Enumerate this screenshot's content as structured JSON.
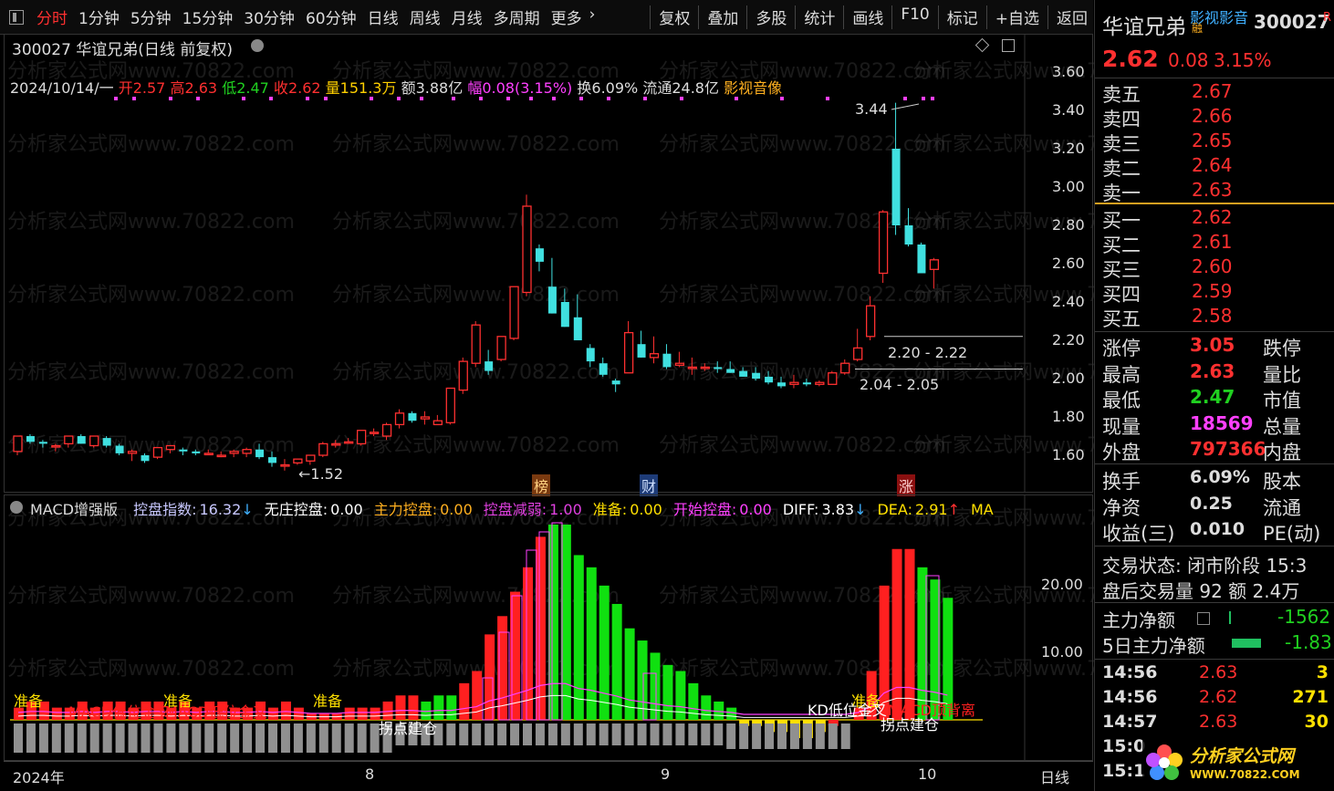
{
  "toolbar": {
    "items": [
      "分时",
      "1分钟",
      "5分钟",
      "15分钟",
      "30分钟",
      "60分钟",
      "日线",
      "周线",
      "月线",
      "多周期",
      "更多"
    ],
    "right_items": [
      "复权",
      "叠加",
      "多股",
      "统计",
      "画线",
      "F10",
      "标记",
      "+自选",
      "返回"
    ]
  },
  "main": {
    "title": "300027 华谊兄弟(日线 前复权)",
    "info": {
      "date": "2024/10/14/一",
      "open_label": "开",
      "open": "2.57",
      "high_label": "高",
      "high": "2.63",
      "low_label": "低",
      "low": "2.47",
      "close_label": "收",
      "close": "2.62",
      "vol_label": "量",
      "vol": "151.3万",
      "amt_label": "额",
      "amt": "3.88亿",
      "chg_label": "幅",
      "chg": "0.08(3.15%)",
      "turn_label": "换",
      "turn": "6.09%",
      "float_label": "流通",
      "float": "24.8亿",
      "sector": "影视音像"
    },
    "yticks": [
      "3.60",
      "3.40",
      "3.20",
      "3.00",
      "2.80",
      "2.60",
      "2.40",
      "2.20",
      "2.00",
      "1.80",
      "1.60"
    ],
    "annotations": {
      "peak": "3.44",
      "low_mark": "1.52",
      "band1": "2.20 - 2.22",
      "band2": "2.04 - 2.05"
    },
    "markers": {
      "bang": "榜",
      "cai": "财",
      "zhang": "涨"
    }
  },
  "sub": {
    "title": "MACD增强版",
    "items": [
      {
        "label": "控盘指数:",
        "value": "16.32",
        "arrow": "↓",
        "color": "#c8c8ff"
      },
      {
        "label": "无庄控盘:",
        "value": "0.00",
        "arrow": "",
        "color": "#ffffff"
      },
      {
        "label": "主力控盘:",
        "value": "0.00",
        "arrow": "",
        "color": "#ffb020"
      },
      {
        "label": "控盘减弱:",
        "value": "1.00",
        "arrow": "",
        "color": "#e040e0"
      },
      {
        "label": "准备:",
        "value": "0.00",
        "arrow": "",
        "color": "#ffe000"
      },
      {
        "label": "开始控盘:",
        "value": "0.00",
        "arrow": "",
        "color": "#ff40ff"
      },
      {
        "label": "DIFF:",
        "value": "3.83",
        "arrow": "↓",
        "color": "#ffffff"
      },
      {
        "label": "DEA:",
        "value": "2.91",
        "arrow": "↑",
        "color": "#ffe000"
      },
      {
        "label": "MA",
        "value": "",
        "arrow": "",
        "color": "#ffe000"
      }
    ],
    "yticks": [
      "20.00",
      "10.00"
    ],
    "signals": {
      "zhunbei": "准备",
      "macd_low1": "MACD低位金叉",
      "macd_low2": "MACD低位金叉",
      "guaidian": "拐点建仓",
      "kd_low": "KD低位金叉",
      "macd_top": "MACD顶背离"
    }
  },
  "xaxis": {
    "labels": [
      "2024年",
      "8",
      "9",
      "10"
    ],
    "period": "日线"
  },
  "right": {
    "name": "华谊兄弟",
    "sector": "影视影音",
    "code": "300027",
    "code_suffix": "R",
    "rong": "融",
    "price": "2.62",
    "change": "0.08",
    "pct": "3.15%",
    "asks": [
      {
        "label": "卖五",
        "price": "2.67"
      },
      {
        "label": "卖四",
        "price": "2.66"
      },
      {
        "label": "卖三",
        "price": "2.65"
      },
      {
        "label": "卖二",
        "price": "2.64"
      },
      {
        "label": "卖一",
        "price": "2.63"
      }
    ],
    "bids": [
      {
        "label": "买一",
        "price": "2.62"
      },
      {
        "label": "买二",
        "price": "2.61"
      },
      {
        "label": "买三",
        "price": "2.60"
      },
      {
        "label": "买四",
        "price": "2.59"
      },
      {
        "label": "买五",
        "price": "2.58"
      }
    ],
    "stats": [
      {
        "label": "涨停",
        "value": "3.05",
        "color": "#ff3030",
        "right": "跌停"
      },
      {
        "label": "最高",
        "value": "2.63",
        "color": "#ff3030",
        "right": "量比"
      },
      {
        "label": "最低",
        "value": "2.47",
        "color": "#20d020",
        "right": "市值"
      },
      {
        "label": "现量",
        "value": "18569",
        "color": "#ff40ff",
        "right": "总量"
      },
      {
        "label": "外盘",
        "value": "797366",
        "color": "#ff3030",
        "right": "内盘"
      }
    ],
    "stats2": [
      {
        "label": "换手",
        "value": "6.09%",
        "right": "股本"
      },
      {
        "label": "净资",
        "value": "0.25",
        "right": "流通"
      },
      {
        "label": "收益(三)",
        "value": "0.010",
        "right": "PE(动)"
      }
    ],
    "trade_status": "交易状态: 闭市阶段 15:3",
    "after_hours": "盘后交易量 92 额 2.4万",
    "main_net_label": "主力净额",
    "main_net": "-1562",
    "main5_label": "5日主力净额",
    "main5": "-1.83",
    "ticks": [
      {
        "time": "14:56",
        "price": "2.63",
        "vol": "3"
      },
      {
        "time": "14:56",
        "price": "2.62",
        "vol": "271"
      },
      {
        "time": "14:57",
        "price": "2.63",
        "vol": "30"
      },
      {
        "time": "15:0",
        "price": "",
        "vol": ""
      },
      {
        "time": "15:1",
        "price": "",
        "vol": ""
      }
    ],
    "logo_text": "分析家公式网",
    "logo_url": "WWW.70822.COM"
  },
  "watermark": "分析家公式网www.70822.com",
  "chart_data": {
    "type": "candlestick",
    "title": "300027 华谊兄弟(日线 前复权)",
    "ylim": [
      1.5,
      3.7
    ],
    "candles": [
      [
        1.62,
        1.7,
        1.6,
        1.7
      ],
      [
        1.7,
        1.71,
        1.66,
        1.67
      ],
      [
        1.67,
        1.68,
        1.64,
        1.66
      ],
      [
        1.65,
        1.66,
        1.62,
        1.65
      ],
      [
        1.66,
        1.7,
        1.64,
        1.7
      ],
      [
        1.7,
        1.71,
        1.66,
        1.66
      ],
      [
        1.65,
        1.7,
        1.64,
        1.7
      ],
      [
        1.69,
        1.7,
        1.64,
        1.65
      ],
      [
        1.65,
        1.66,
        1.6,
        1.61
      ],
      [
        1.61,
        1.63,
        1.57,
        1.62
      ],
      [
        1.6,
        1.61,
        1.56,
        1.57
      ],
      [
        1.59,
        1.64,
        1.58,
        1.64
      ],
      [
        1.63,
        1.65,
        1.61,
        1.65
      ],
      [
        1.63,
        1.64,
        1.6,
        1.62
      ],
      [
        1.62,
        1.63,
        1.6,
        1.61
      ],
      [
        1.61,
        1.63,
        1.6,
        1.61
      ],
      [
        1.6,
        1.62,
        1.59,
        1.6
      ],
      [
        1.61,
        1.63,
        1.59,
        1.62
      ],
      [
        1.61,
        1.64,
        1.59,
        1.63
      ],
      [
        1.63,
        1.66,
        1.58,
        1.59
      ],
      [
        1.59,
        1.62,
        1.54,
        1.56
      ],
      [
        1.55,
        1.58,
        1.52,
        1.55
      ],
      [
        1.56,
        1.58,
        1.55,
        1.58
      ],
      [
        1.57,
        1.6,
        1.55,
        1.6
      ],
      [
        1.6,
        1.67,
        1.59,
        1.66
      ],
      [
        1.66,
        1.68,
        1.64,
        1.66
      ],
      [
        1.67,
        1.69,
        1.66,
        1.67
      ],
      [
        1.66,
        1.73,
        1.65,
        1.73
      ],
      [
        1.72,
        1.74,
        1.7,
        1.72
      ],
      [
        1.7,
        1.77,
        1.68,
        1.76
      ],
      [
        1.76,
        1.84,
        1.74,
        1.82
      ],
      [
        1.82,
        1.83,
        1.77,
        1.78
      ],
      [
        1.79,
        1.83,
        1.76,
        1.8
      ],
      [
        1.76,
        1.81,
        1.76,
        1.78
      ],
      [
        1.77,
        1.95,
        1.76,
        1.95
      ],
      [
        1.94,
        2.11,
        1.92,
        2.09
      ],
      [
        2.08,
        2.3,
        2.06,
        2.28
      ],
      [
        2.09,
        2.15,
        2.02,
        2.04
      ],
      [
        2.1,
        2.22,
        2.09,
        2.22
      ],
      [
        2.21,
        2.48,
        2.2,
        2.48
      ],
      [
        2.45,
        2.96,
        2.43,
        2.9
      ],
      [
        2.68,
        2.7,
        2.56,
        2.61
      ],
      [
        2.48,
        2.63,
        2.34,
        2.34
      ],
      [
        2.4,
        2.47,
        2.27,
        2.27
      ],
      [
        2.32,
        2.44,
        2.2,
        2.2
      ],
      [
        2.16,
        2.18,
        2.06,
        2.09
      ],
      [
        2.08,
        2.11,
        2.01,
        2.02
      ],
      [
        1.99,
        2.0,
        1.93,
        1.97
      ],
      [
        2.03,
        2.3,
        2.03,
        2.24
      ],
      [
        2.18,
        2.25,
        2.11,
        2.11
      ],
      [
        2.11,
        2.22,
        2.08,
        2.13
      ],
      [
        2.13,
        2.18,
        2.05,
        2.06
      ],
      [
        2.07,
        2.14,
        2.06,
        2.08
      ],
      [
        2.06,
        2.11,
        2.02,
        2.06
      ],
      [
        2.06,
        2.08,
        2.04,
        2.06
      ],
      [
        2.06,
        2.09,
        2.03,
        2.05
      ],
      [
        2.05,
        2.09,
        2.03,
        2.03
      ],
      [
        2.04,
        2.06,
        2.01,
        2.01
      ],
      [
        2.03,
        2.06,
        1.99,
        2.0
      ],
      [
        2.01,
        2.04,
        1.97,
        1.98
      ],
      [
        1.98,
        2.01,
        1.95,
        1.96
      ],
      [
        1.97,
        2.02,
        1.95,
        1.98
      ],
      [
        1.98,
        2.0,
        1.96,
        1.97
      ],
      [
        1.97,
        1.99,
        1.96,
        1.98
      ],
      [
        1.97,
        2.04,
        1.97,
        2.03
      ],
      [
        2.03,
        2.1,
        2.02,
        2.08
      ],
      [
        2.1,
        2.26,
        2.09,
        2.16
      ],
      [
        2.22,
        2.43,
        2.2,
        2.38
      ],
      [
        2.55,
        2.88,
        2.5,
        2.87
      ],
      [
        3.2,
        3.44,
        2.75,
        2.8
      ],
      [
        2.8,
        2.89,
        2.69,
        2.7
      ],
      [
        2.7,
        2.71,
        2.55,
        2.55
      ],
      [
        2.57,
        2.63,
        2.47,
        2.62
      ]
    ],
    "macd_hist": [
      2,
      3,
      3,
      2,
      2,
      3,
      2,
      3,
      3,
      2,
      3,
      3,
      2,
      3,
      2,
      3,
      3,
      2,
      2,
      3,
      2,
      3,
      2,
      1,
      1,
      1,
      2,
      2,
      2,
      3,
      4,
      4,
      3,
      4,
      4,
      6,
      8,
      14,
      17,
      21,
      25,
      30,
      32,
      32,
      27,
      25,
      22,
      19,
      15,
      13,
      11,
      9,
      8,
      6,
      4,
      3,
      2,
      -1,
      -1,
      -2,
      -2,
      -3,
      -3,
      -2,
      -1,
      0,
      2,
      8,
      22,
      28,
      28,
      25,
      23,
      20
    ],
    "macd_color": [
      "r",
      "r",
      "r",
      "r",
      "r",
      "r",
      "r",
      "r",
      "r",
      "r",
      "r",
      "r",
      "r",
      "r",
      "r",
      "r",
      "r",
      "r",
      "r",
      "r",
      "r",
      "r",
      "r",
      "r",
      "r",
      "r",
      "r",
      "r",
      "r",
      "r",
      "r",
      "r",
      "g",
      "g",
      "g",
      "r",
      "r",
      "r",
      "r",
      "r",
      "r",
      "r",
      "g",
      "g",
      "g",
      "g",
      "g",
      "g",
      "g",
      "g",
      "g",
      "g",
      "g",
      "g",
      "g",
      "g",
      "g",
      "y",
      "y",
      "y",
      "y",
      "y",
      "y",
      "y",
      "r",
      "r",
      "r",
      "r",
      "r",
      "r",
      "r",
      "g",
      "g",
      "g"
    ]
  }
}
